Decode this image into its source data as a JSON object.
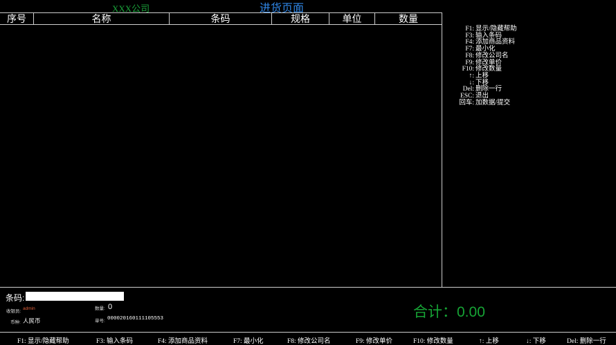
{
  "header": {
    "company": "XXX公司",
    "title": "进货页面"
  },
  "table": {
    "columns": [
      "序号",
      "名称",
      "条码",
      "规格",
      "单位",
      "数量"
    ],
    "rows": []
  },
  "help_panel": {
    "items": [
      {
        "key": "F1:",
        "label": "显示/隐藏帮助"
      },
      {
        "key": "F3:",
        "label": "输入条码"
      },
      {
        "key": "F4:",
        "label": "添加商品资料"
      },
      {
        "key": "F7:",
        "label": "最小化"
      },
      {
        "key": "F8:",
        "label": "修改公司名"
      },
      {
        "key": "F9:",
        "label": "修改单价"
      },
      {
        "key": "F10:",
        "label": "修改数量"
      },
      {
        "key": "↑:",
        "label": "上移"
      },
      {
        "key": "↓:",
        "label": "下移"
      },
      {
        "key": "Del:",
        "label": "删除一行"
      },
      {
        "key": "ESC:",
        "label": "退出"
      },
      {
        "key": "回车:",
        "label": "加数据/提交"
      }
    ]
  },
  "entry": {
    "barcode_label": "条码:",
    "barcode_value": "",
    "cashier_label": "收银员:",
    "cashier_value": "admin",
    "currency_label": "币种:",
    "currency_value": "人民币",
    "qty_label": "数量:",
    "qty_value": "0",
    "docno_label": "单号:",
    "docno_value": "000020160111105553"
  },
  "summary": {
    "total_text": "合计：0.00"
  },
  "footer": {
    "items": [
      "F1: 显示/隐藏帮助",
      "F3: 输入条码",
      "F4: 添加商品资料",
      "F7: 最小化",
      "F8: 修改公司名",
      "F9: 修改单价",
      "F10: 修改数量",
      "↑: 上移",
      "↓: 下移",
      "Del: 删除一行"
    ]
  },
  "colors": {
    "background": "#000000",
    "company": "#1aa33a",
    "title": "#2f86e6",
    "total": "#16a435",
    "cashier": "#e0603a"
  }
}
